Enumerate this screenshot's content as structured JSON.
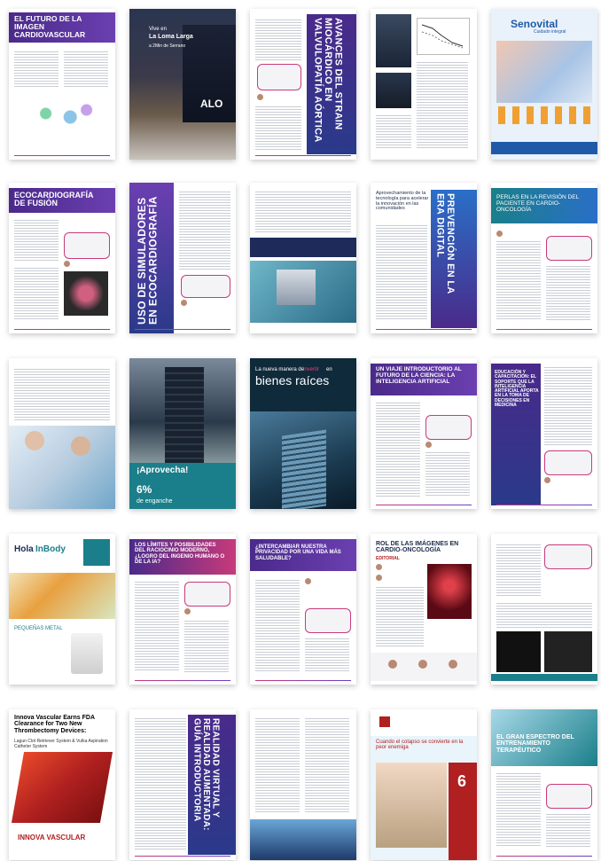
{
  "colors": {
    "purple": "#4a2a8a",
    "navy": "#1e2a5a",
    "teal": "#1a7f8a",
    "magenta": "#c73a7b",
    "red": "#b02020",
    "blue": "#2a6fc7"
  },
  "pages": [
    {
      "title": "EL FUTURO DE LA IMAGEN CARDIOVASCULAR"
    },
    {
      "ad_line1": "Vive en",
      "ad_line2": "La Loma Larga",
      "ad_line3": "a 2Min de Serrano",
      "brand": "ALO"
    },
    {
      "title": "AVANCES DEL STRAIN MIOCÁRDICO EN VALVULOPATÍA AÓRTICA"
    },
    {},
    {
      "brand": "Senovital",
      "tagline": "Cuidado integral"
    },
    {
      "title": "ECOCARDIOGRAFÍA DE FUSIÓN"
    },
    {
      "title": "USO DE SIMULADORES EN ECOCARDIOGRAFÍA"
    },
    {},
    {
      "heading": "Aprovechamiento de la tecnología para acelerar la innovación en las comunidades",
      "title": "PREVENCIÓN EN LA ERA DIGITAL"
    },
    {
      "title": "PERLAS EN LA REVISIÓN DEL PACIENTE EN CARDIO-ONCOLOGÍA"
    },
    {},
    {
      "promo": "¡Aprovecha!",
      "amount": "6%",
      "amount_label": "de enganche"
    },
    {
      "headline_a": "La nueva manera de",
      "headline_b": "invertir",
      "headline_c": "en",
      "headline_big": "bienes raíces"
    },
    {
      "title": "UN VIAJE INTRODUCTORIO AL FUTURO DE LA CIENCIA: LA INTELIGENCIA ARTIFICIAL"
    },
    {
      "title": "EDUCACIÓN Y CAPACITACIÓN: EL SOPORTE QUE LA INTELIGENCIA ARTIFICIAL APORTA EN LA TOMA DE DECISIONES EN MEDICINA"
    },
    {
      "brand_a": "Hola",
      "brand_b": "InBody",
      "caption": "PEQUEÑAS METAL"
    },
    {
      "title": "LOS LÍMITES Y POSIBILIDADES DEL RACIOCINIO MODERNO, ¿LOGRO DEL INGENIO HUMANO O DE LA IA?"
    },
    {
      "title": "¿INTERCAMBIAR NUESTRA PRIVACIDAD POR UNA VIDA MÁS SALUDABLE?"
    },
    {
      "title": "ROL DE LAS IMÁGENES EN CARDIO-ONCOLOGÍA",
      "sub": "EDITORIAL"
    },
    {},
    {
      "headline": "Innova Vascular Earns FDA Clearance for Two New Thrombectomy Devices:",
      "sub": "Lagun Clot Retriever System & Vulka Aspiration Catheter System",
      "brand": "INNOVA VASCULAR"
    },
    {
      "title": "REALIDAD VIRTUAL Y REALIDAD AUMENTADA: GUÍA INTRODUCTORIA"
    },
    {},
    {
      "headline": "Cuando el colapso se convierte en la peor enemiga",
      "day": "6"
    },
    {
      "title": "EL GRAN ESPECTRO DEL ENTRENAMIENTO TERAPÉUTICO"
    }
  ]
}
